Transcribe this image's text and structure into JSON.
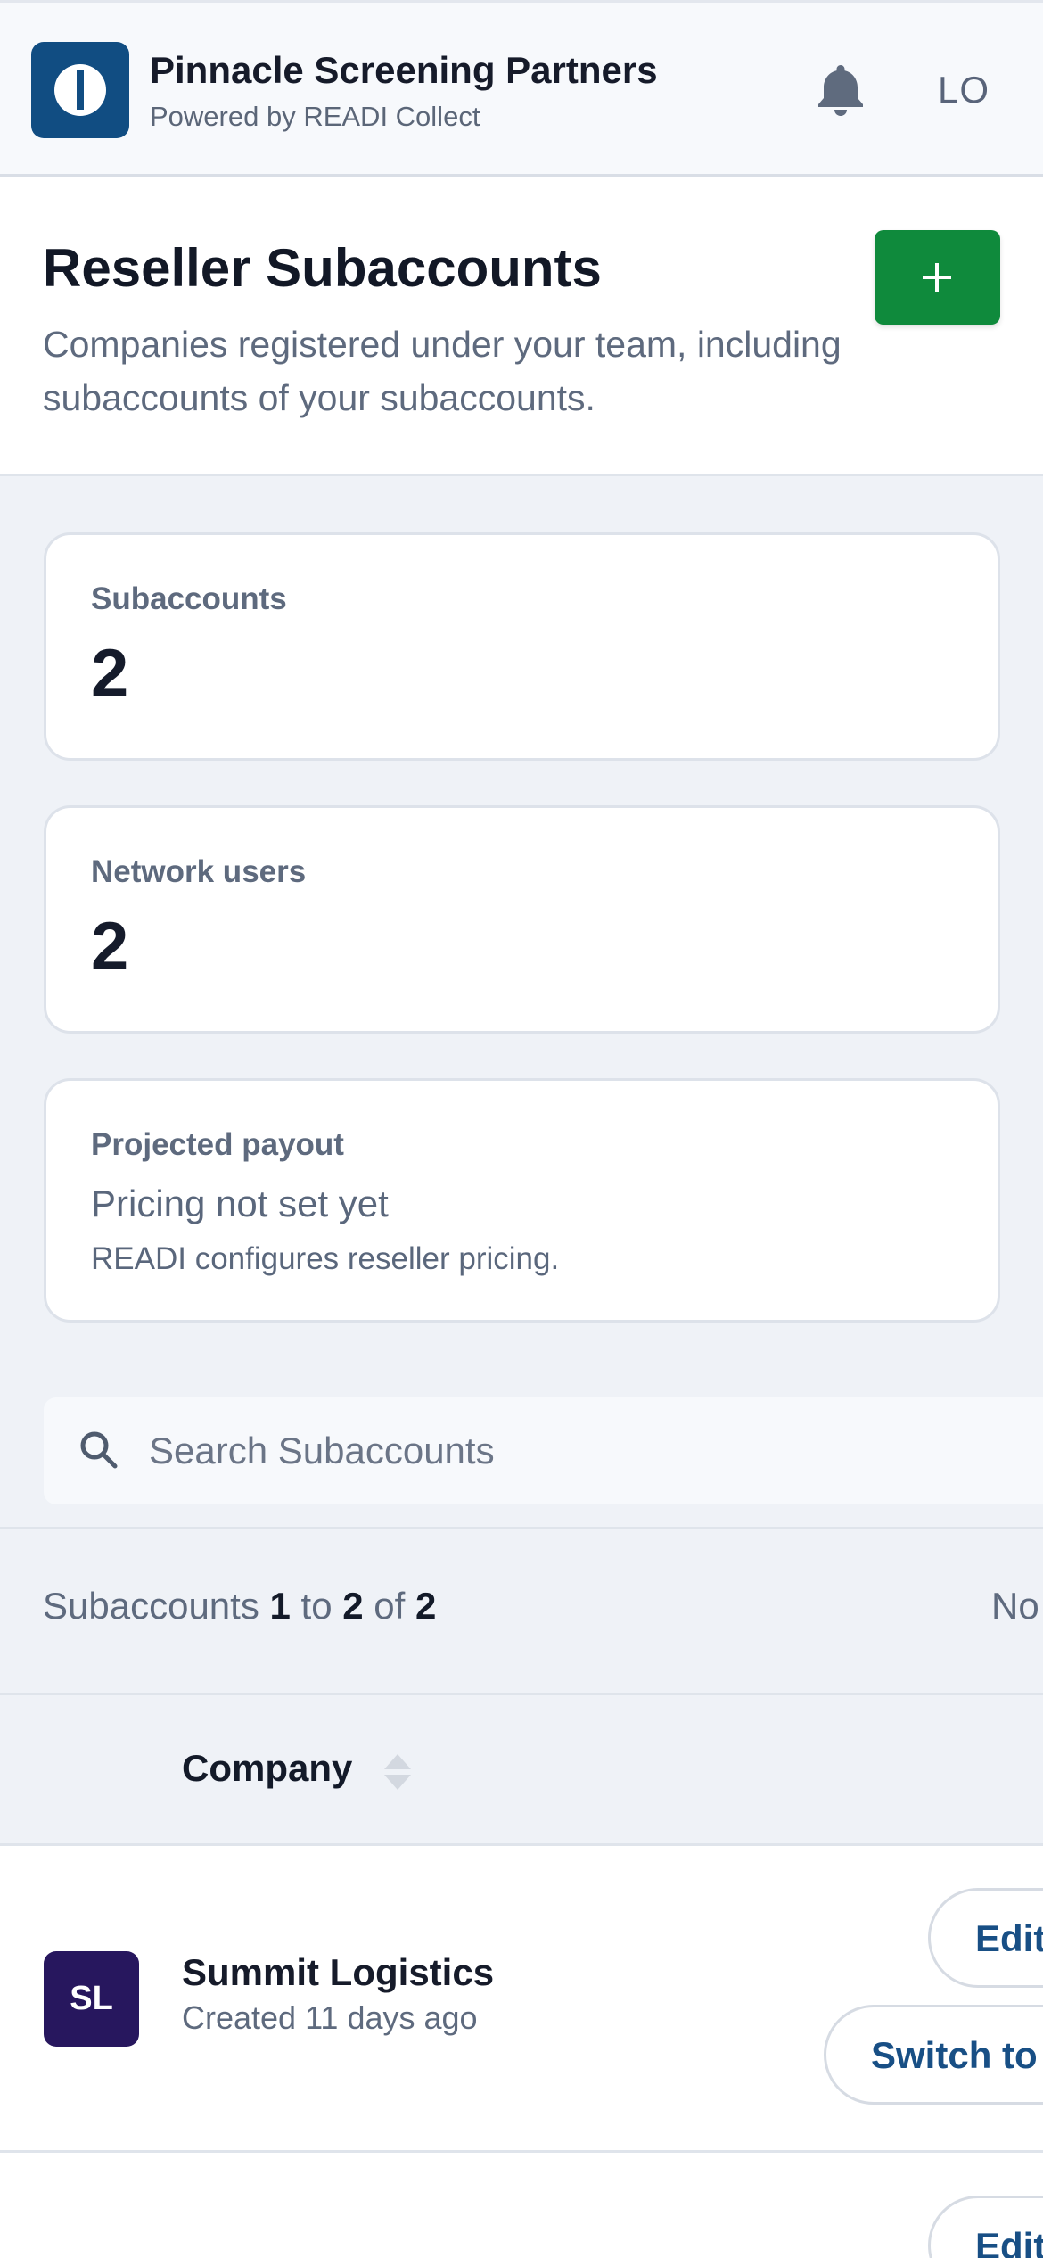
{
  "header": {
    "org_name": "Pinnacle Screening Partners",
    "org_subtitle": "Powered by READI Collect",
    "user_initials": "LO"
  },
  "page": {
    "title": "Reseller Subaccounts",
    "description": "Companies registered under your team, including subaccounts of your subaccounts.",
    "add_button_label": "+"
  },
  "stats": {
    "subaccounts": {
      "label": "Subaccounts",
      "value": "2"
    },
    "network_users": {
      "label": "Network users",
      "value": "2"
    },
    "payout": {
      "label": "Projected payout",
      "status": "Pricing not set yet",
      "note": "READI configures reseller pricing."
    }
  },
  "search": {
    "placeholder": "Search Subaccounts",
    "value": ""
  },
  "results": {
    "prefix": "Subaccounts",
    "from": "1",
    "to_word": "to",
    "to": "2",
    "of_word": "of",
    "total": "2",
    "right_text": "No"
  },
  "table": {
    "columns": {
      "company": "Company"
    },
    "rows": [
      {
        "initials": "SL",
        "name": "Summit Logistics",
        "created": "Created 11 days ago",
        "edit_label": "Edit",
        "switch_label": "Switch to"
      },
      {
        "edit_label": "Edit"
      }
    ]
  },
  "colors": {
    "brand": "#114d82",
    "accent_green": "#0f8a3c",
    "avatar_sl": "#27175e"
  }
}
